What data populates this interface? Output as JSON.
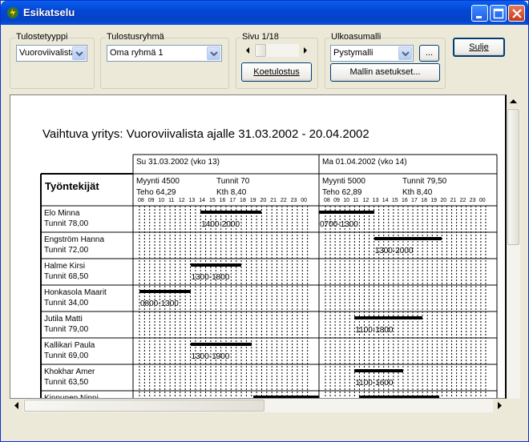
{
  "window": {
    "title": "Esikatselu"
  },
  "toolbar": {
    "tulostetyyppi": {
      "label": "Tulostetyyppi",
      "value": "Vuoroviivalista"
    },
    "tulostusryhma": {
      "label": "Tulostusryhmä",
      "value": "Oma ryhmä 1"
    },
    "sivu": {
      "label": "Sivu 1/18"
    },
    "koetulostus": "Koetulostus",
    "ulkoasumalli": {
      "label": "Ulkoasumalli",
      "value": "Pystymalli"
    },
    "ellipsis": "...",
    "mallin_asetukset": "Mallin asetukset...",
    "sulje": "Sulje"
  },
  "report": {
    "title": "Vaihtuva yritys: Vuoroviivalista ajalle 31.03.2002 - 20.04.2002",
    "employees_header": "Työntekijät",
    "days": [
      {
        "date": "Su 31.03.2002  (vko 13)",
        "sales": "Myynti 4500",
        "hours": "Tunnit 70",
        "efficiency": "Teho 64,29",
        "kth": "Kth 8,40"
      },
      {
        "date": "Ma 01.04.2002  (vko 14)",
        "sales": "Myynti 5000",
        "hours": "Tunnit 79,50",
        "efficiency": "Teho 62,89",
        "kth": "Kth 8,40"
      }
    ],
    "hour_labels": [
      "08",
      "09",
      "10",
      "11",
      "12",
      "13",
      "14",
      "15",
      "16",
      "17",
      "18",
      "19",
      "20",
      "21",
      "22",
      "23",
      "00"
    ],
    "employees": [
      {
        "name": "Elo Minna",
        "hours": "Tunnit 78,00",
        "shifts": [
          "1400-2000",
          "0700-1300"
        ]
      },
      {
        "name": "Engström Hanna",
        "hours": "Tunnit 72,00",
        "shifts": [
          "",
          "1300-2000"
        ]
      },
      {
        "name": "Halme Kirsi",
        "hours": "Tunnit 68,50",
        "shifts": [
          "1300-1800",
          ""
        ]
      },
      {
        "name": "Honkasola Maarit",
        "hours": "Tunnit 34,00",
        "shifts": [
          "0800-1300",
          ""
        ]
      },
      {
        "name": "Jutila Matti",
        "hours": "Tunnit 79,00",
        "shifts": [
          "",
          "1100-1800"
        ]
      },
      {
        "name": "Kallikari Paula",
        "hours": "Tunnit 69,00",
        "shifts": [
          "1300-1900",
          ""
        ]
      },
      {
        "name": "Khokhar Amer",
        "hours": "Tunnit 63,50",
        "shifts": [
          "",
          "1100-1600"
        ]
      },
      {
        "name": "Kinnunen Ninni",
        "hours": "",
        "shifts": [
          "",
          ""
        ]
      }
    ]
  }
}
